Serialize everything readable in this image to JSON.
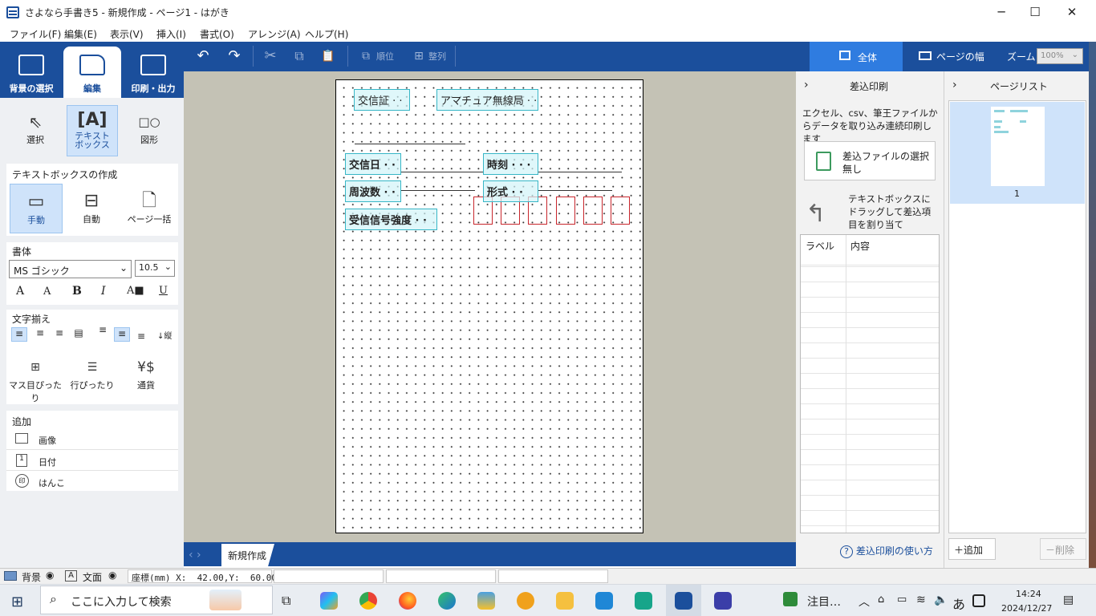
{
  "window": {
    "title": "さよなら手書き5 - 新規作成 - ページ1 - はがき",
    "minimize": "─",
    "maximize": "☐",
    "close": "✕"
  },
  "menu": [
    "ファイル(F)",
    "編集(E)",
    "表示(V)",
    "挿入(I)",
    "書式(O)",
    "アレンジ(A)",
    "ヘルプ(H)"
  ],
  "main_tabs": {
    "background": "背景の選択",
    "edit": "編集",
    "print": "印刷・出力"
  },
  "toolbar": {
    "undo": "↶",
    "redo": "↷",
    "cut": "✂",
    "copy": "⧉",
    "paste": "📋",
    "order": "順位",
    "align": "整列"
  },
  "view": {
    "whole": "全体",
    "page_width": "ページの幅",
    "zoom_label": "ズーム",
    "zoom_value": "100%"
  },
  "tools": {
    "select": "選択",
    "textbox_l1": "テキスト",
    "textbox_l2": "ボックス",
    "shape": "図形"
  },
  "create": {
    "title": "テキストボックスの作成",
    "manual": "手動",
    "auto": "自動",
    "page_all": "ページ一括"
  },
  "font": {
    "title": "書体",
    "family": "MS ゴシック",
    "size": "10.5",
    "grow": "A",
    "shrink": "A",
    "bold": "B",
    "italic": "I",
    "color": "A",
    "underline": "U"
  },
  "alignment": {
    "title": "文字揃え",
    "vertical": "縦",
    "grid_fit": "マス目ぴったり",
    "line_fit": "行ぴったり",
    "currency": "通貨"
  },
  "add": {
    "title": "追加",
    "image": "画像",
    "date": "日付",
    "stamp": "はんこ"
  },
  "card": {
    "fields": {
      "cert": "交信証 · ·",
      "station": "アマチュア無線局 · ·",
      "date": "交信日 · ·",
      "time": "時刻 · · ·",
      "freq": "周波数 · ·",
      "mode": "形式 · ·",
      "signal": "受信信号強度 · ·"
    }
  },
  "doc_tab": "新規作成",
  "merge": {
    "title": "差込印刷",
    "desc": "エクセル、csv、筆王ファイルからデータを取り込み連続印刷します",
    "select_file": "差込ファイルの選択",
    "file_state": "無し",
    "drag_hint": "テキストボックスにドラッグして差込項目を割り当て",
    "col_label": "ラベル",
    "col_content": "内容",
    "help": "差込印刷の使い方"
  },
  "pagelist": {
    "title": "ページリスト",
    "page_number": "1",
    "add": "追加",
    "delete": "削除"
  },
  "status": {
    "bg": "背景",
    "text": "文面",
    "coords": "座標(mm) X:  42.00,Y:  60.00"
  },
  "taskbar": {
    "search": "ここに入力して検索",
    "notice": "注目…",
    "ime": "あ",
    "time": "14:24",
    "date": "2024/12/27"
  }
}
